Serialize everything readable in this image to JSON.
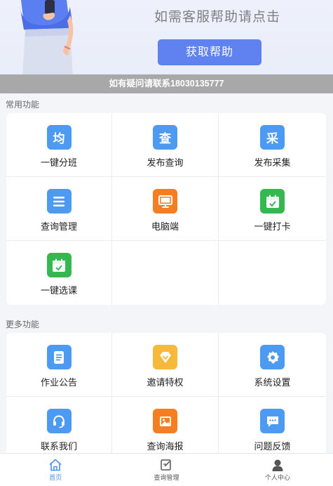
{
  "banner": {
    "help_text": "如需客服帮助请点击",
    "help_button": "获取帮助",
    "contact": "如有疑问请联系18030135777"
  },
  "common": {
    "title": "常用功能",
    "items": [
      {
        "label": "一键分班",
        "glyph": "均",
        "icon": "assign-class-icon",
        "color": "#4d9af3"
      },
      {
        "label": "发布查询",
        "glyph": "查",
        "icon": "publish-query-icon",
        "color": "#4d9af3"
      },
      {
        "label": "发布采集",
        "glyph": "采",
        "icon": "publish-collect-icon",
        "color": "#4d9af3"
      },
      {
        "label": "查询管理",
        "icon": "list-icon",
        "color": "#4d9af3"
      },
      {
        "label": "电脑端",
        "icon": "monitor-icon",
        "color": "#f57d22"
      },
      {
        "label": "一键打卡",
        "icon": "calendar-check-icon",
        "color": "#34b84f"
      },
      {
        "label": "一键选课",
        "icon": "calendar-check-icon",
        "color": "#34b84f"
      }
    ]
  },
  "more": {
    "title": "更多功能",
    "items": [
      {
        "label": "作业公告",
        "icon": "document-icon",
        "color": "#4d9af3"
      },
      {
        "label": "邀请特权",
        "icon": "diamond-icon",
        "color": "#f7b93a"
      },
      {
        "label": "系统设置",
        "icon": "gear-icon",
        "color": "#4d9af3"
      },
      {
        "label": "联系我们",
        "icon": "headset-icon",
        "color": "#4d9af3"
      },
      {
        "label": "查询海报",
        "icon": "picture-icon",
        "color": "#f57d22"
      },
      {
        "label": "问题反馈",
        "icon": "chat-icon",
        "color": "#4d9af3"
      }
    ]
  },
  "tabbar": {
    "items": [
      {
        "label": "首页",
        "icon": "home-icon",
        "active": true
      },
      {
        "label": "查询管理",
        "icon": "edit-icon",
        "active": false
      },
      {
        "label": "个人中心",
        "icon": "user-icon",
        "active": false
      }
    ]
  }
}
